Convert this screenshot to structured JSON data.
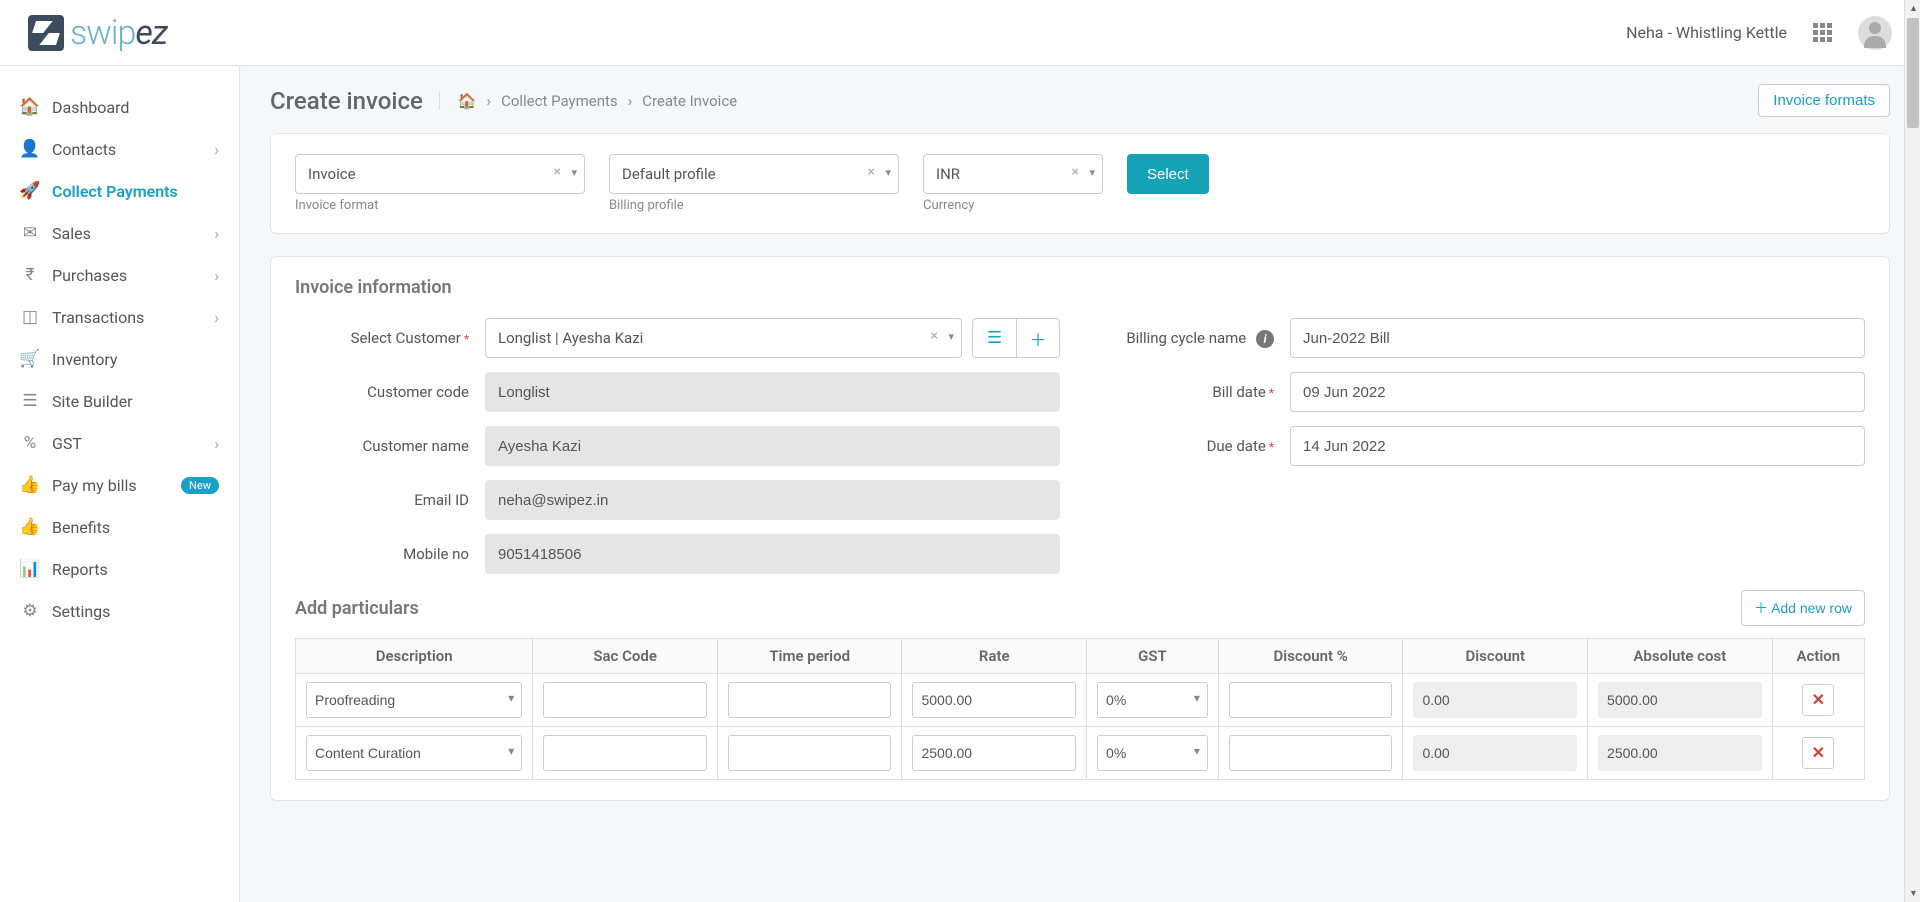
{
  "header": {
    "logo_text_1": "swip",
    "logo_text_2": "ez",
    "user_label": "Neha - Whistling Kettle"
  },
  "sidebar": {
    "items": [
      {
        "label": "Dashboard",
        "icon": "🏠",
        "expand": false,
        "active": false
      },
      {
        "label": "Contacts",
        "icon": "👤",
        "expand": true,
        "active": false
      },
      {
        "label": "Collect Payments",
        "icon": "🚀",
        "expand": false,
        "active": true
      },
      {
        "label": "Sales",
        "icon": "✉",
        "expand": true,
        "active": false
      },
      {
        "label": "Purchases",
        "icon": "₹",
        "expand": true,
        "active": false
      },
      {
        "label": "Transactions",
        "icon": "◫",
        "expand": true,
        "active": false
      },
      {
        "label": "Inventory",
        "icon": "🛒",
        "expand": false,
        "active": false
      },
      {
        "label": "Site Builder",
        "icon": "☰",
        "expand": false,
        "active": false
      },
      {
        "label": "GST",
        "icon": "%",
        "expand": true,
        "active": false
      },
      {
        "label": "Pay my bills",
        "icon": "👍",
        "expand": false,
        "active": false,
        "badge": "New"
      },
      {
        "label": "Benefits",
        "icon": "👍",
        "expand": false,
        "active": false
      },
      {
        "label": "Reports",
        "icon": "📊",
        "expand": false,
        "active": false
      },
      {
        "label": "Settings",
        "icon": "⚙",
        "expand": false,
        "active": false
      }
    ]
  },
  "page": {
    "title": "Create invoice",
    "breadcrumb": {
      "home_icon": "🏠",
      "l1": "Collect Payments",
      "l2": "Create Invoice"
    },
    "invoice_formats_btn": "Invoice formats"
  },
  "selectors": {
    "invoice_format": {
      "value": "Invoice",
      "label": "Invoice format"
    },
    "billing_profile": {
      "value": "Default profile",
      "label": "Billing profile"
    },
    "currency": {
      "value": "INR",
      "label": "Currency"
    },
    "select_btn": "Select"
  },
  "invoice_info": {
    "title": "Invoice information",
    "select_customer": {
      "label": "Select Customer",
      "value": "Longlist | Ayesha Kazi"
    },
    "customer_code": {
      "label": "Customer code",
      "value": "Longlist"
    },
    "customer_name": {
      "label": "Customer name",
      "value": "Ayesha Kazi"
    },
    "email": {
      "label": "Email ID",
      "value": "neha@swipez.in"
    },
    "mobile": {
      "label": "Mobile no",
      "value": "9051418506"
    },
    "billing_cycle": {
      "label": "Billing cycle name",
      "value": "Jun-2022 Bill"
    },
    "bill_date": {
      "label": "Bill date",
      "value": "09 Jun 2022"
    },
    "due_date": {
      "label": "Due date",
      "value": "14 Jun 2022"
    }
  },
  "particulars": {
    "title": "Add particulars",
    "add_row_btn": "Add new row",
    "headers": {
      "desc": "Description",
      "sac": "Sac Code",
      "time": "Time period",
      "rate": "Rate",
      "gst": "GST",
      "discpct": "Discount %",
      "disc": "Discount",
      "abs": "Absolute cost",
      "act": "Action"
    },
    "rows": [
      {
        "desc": "Proofreading",
        "sac": "",
        "time": "",
        "rate": "5000.00",
        "gst": "0%",
        "discpct": "",
        "disc": "0.00",
        "abs": "5000.00"
      },
      {
        "desc": "Content Curation",
        "sac": "",
        "time": "",
        "rate": "2500.00",
        "gst": "0%",
        "discpct": "",
        "disc": "0.00",
        "abs": "2500.00"
      }
    ]
  },
  "colors": {
    "teal": "#16a3b8",
    "link": "#18a0c9"
  }
}
